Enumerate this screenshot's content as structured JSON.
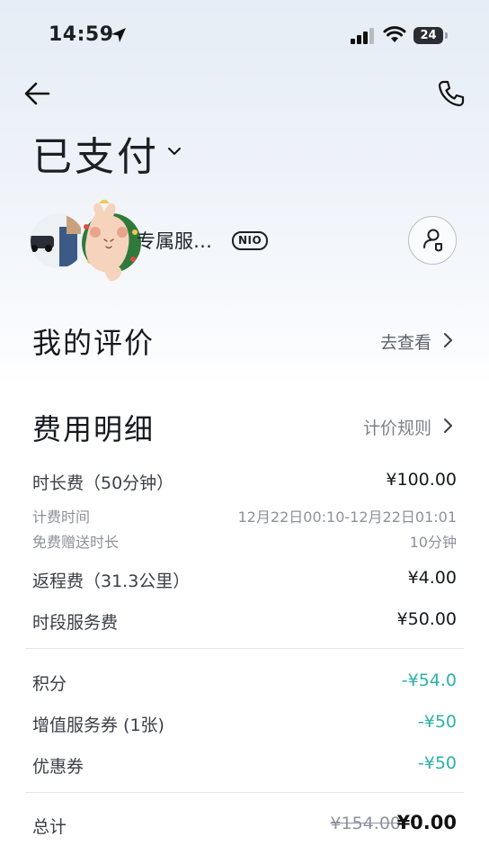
{
  "status_bar": {
    "time": "14:59",
    "battery": "24"
  },
  "header": {
    "title": "已支付"
  },
  "driver": {
    "name": "专属服…",
    "badge": "NIO"
  },
  "review": {
    "title": "我的评价",
    "link": "去查看"
  },
  "fees": {
    "title": "费用明细",
    "link": "计价规则",
    "duration_fee": {
      "label": "时长费（50分钟）",
      "value": "¥100.00"
    },
    "billing_time": {
      "label": "计费时间",
      "value": "12月22日00:10-12月22日01:01"
    },
    "free_time": {
      "label": "免费赠送时长",
      "value": "10分钟"
    },
    "return_fee": {
      "label": "返程费（31.3公里）",
      "value": "¥4.00"
    },
    "period_fee": {
      "label": "时段服务费",
      "value": "¥50.00"
    },
    "points": {
      "label": "积分",
      "value": "-¥54.0"
    },
    "value_coupon": {
      "label": "增值服务券 (1张)",
      "value": "-¥50"
    },
    "coupon": {
      "label": "优惠券",
      "value": "-¥50"
    },
    "total": {
      "label": "总计",
      "original": "¥154.00",
      "final": "¥0.00"
    }
  },
  "colors": {
    "discount": "#2bb1a9",
    "text": "#1c1f26"
  }
}
